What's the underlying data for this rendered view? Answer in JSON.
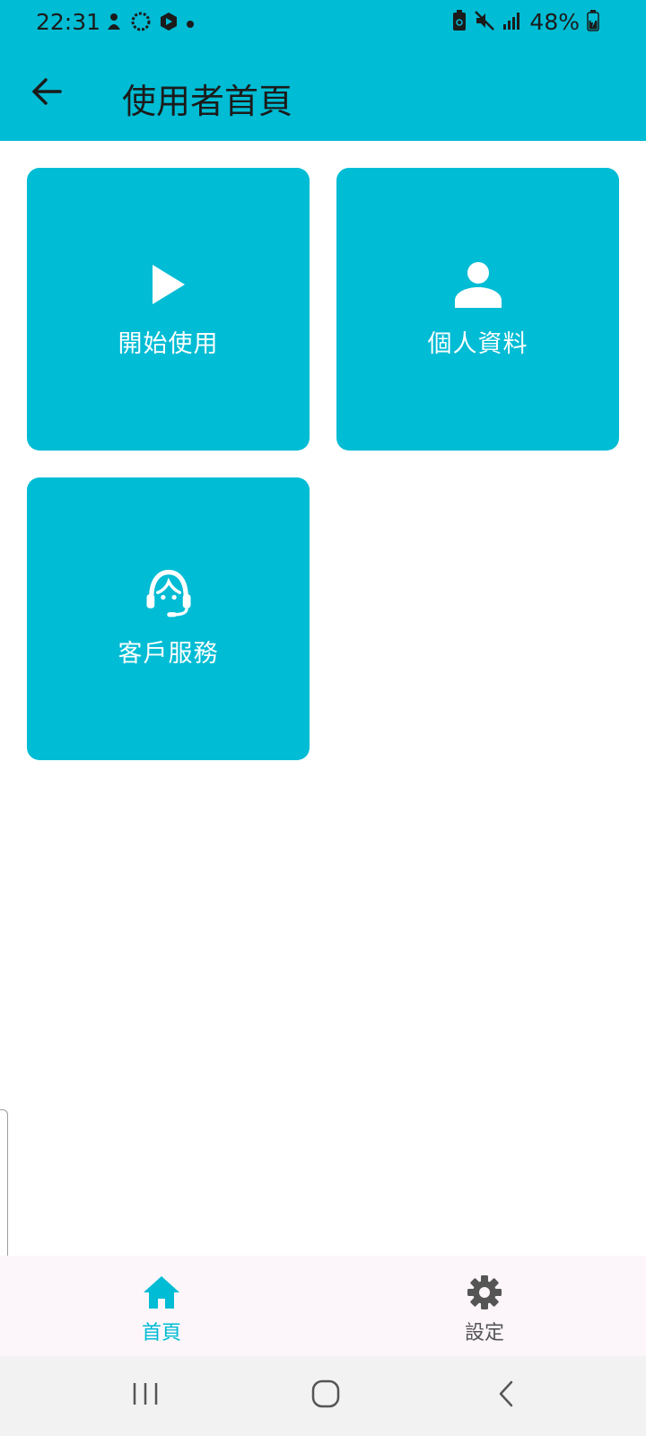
{
  "status_bar": {
    "time": "22:31",
    "battery_percent": "48%",
    "icons_left": [
      "notification-icon",
      "sync-icon",
      "app-icon",
      "dot-icon"
    ],
    "icons_right": [
      "battery-saver-icon",
      "mute-icon",
      "signal-icon",
      "battery-icon"
    ]
  },
  "app_bar": {
    "title": "使用者首頁",
    "back_icon": "arrow-back-icon"
  },
  "tiles": [
    {
      "label": "開始使用",
      "icon": "play-icon"
    },
    {
      "label": "個人資料",
      "icon": "person-icon"
    },
    {
      "label": "客戶服務",
      "icon": "headset-icon"
    }
  ],
  "bottom_nav": {
    "items": [
      {
        "label": "首頁",
        "icon": "home-icon",
        "active": true
      },
      {
        "label": "設定",
        "icon": "gear-icon",
        "active": false
      }
    ]
  },
  "system_nav": [
    "recent-apps-icon",
    "home-circle-icon",
    "back-chevron-icon"
  ],
  "colors": {
    "primary": "#00BCD4",
    "bottom_nav_bg": "#FCF6FB",
    "system_nav_bg": "#F2F2F2",
    "text_dark": "#1b1b1b",
    "inactive": "#555555"
  }
}
